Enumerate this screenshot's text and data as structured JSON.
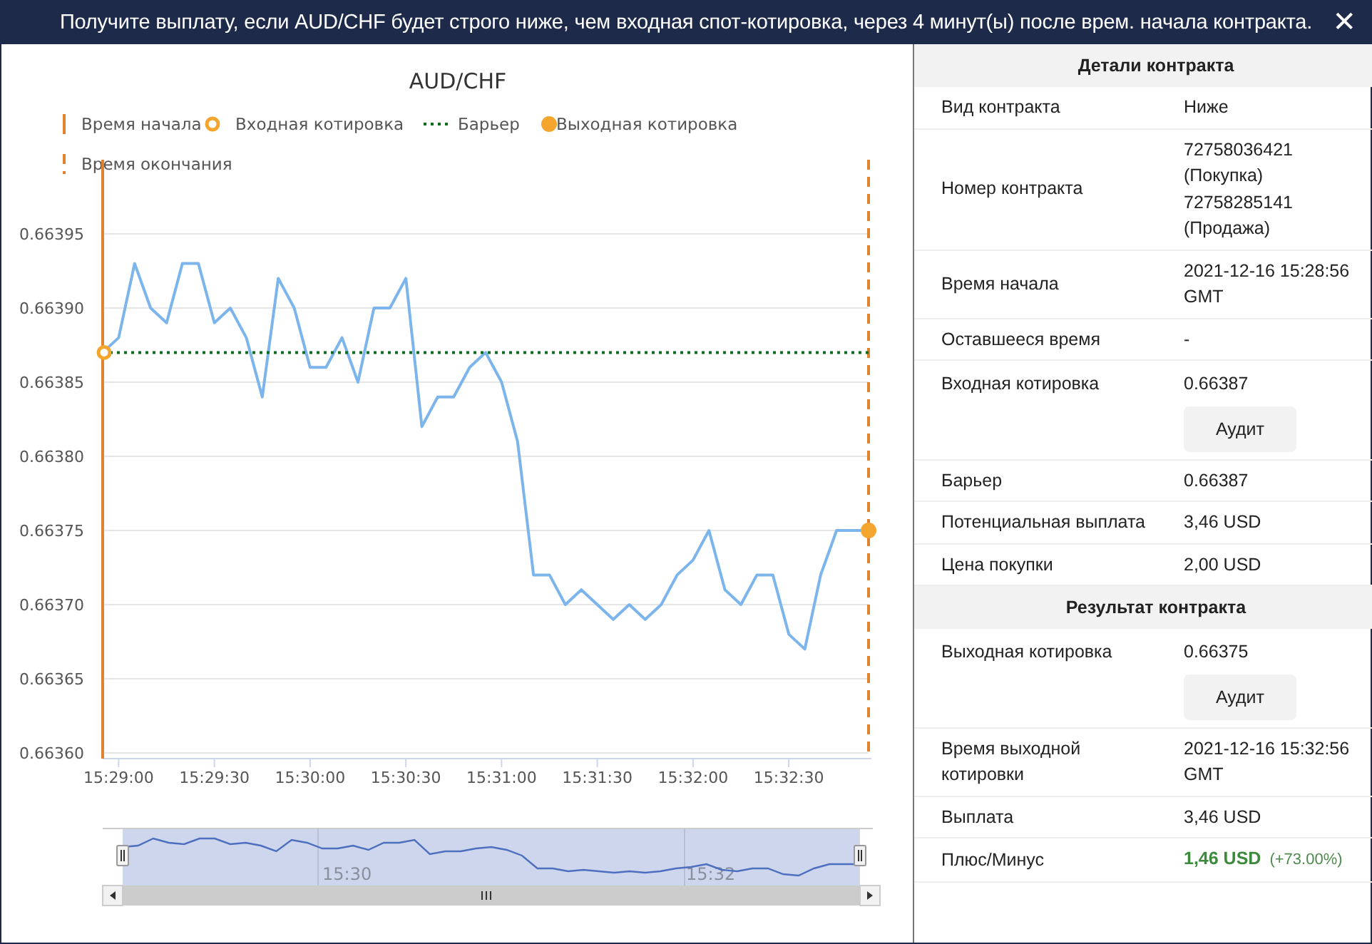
{
  "window": {
    "title": "Получите выплату, если AUD/CHF будет строго ниже, чем входная спот-котировка, через 4 минут(ы) после врем. начала контракта.",
    "close": "✕"
  },
  "chart": {
    "title": "AUD/CHF",
    "legend": [
      {
        "kind": "start_line",
        "label": "Время начала"
      },
      {
        "kind": "entry_spot",
        "label": "Входная котировка"
      },
      {
        "kind": "barrier",
        "label": "Барьер"
      },
      {
        "kind": "exit_spot",
        "label": "Выходная котировка"
      },
      {
        "kind": "end_line",
        "label": "Время окончания"
      }
    ],
    "chart_data": {
      "type": "line",
      "categories": [
        null,
        "15:29:00",
        null,
        null,
        null,
        null,
        null,
        "15:29:30",
        null,
        null,
        null,
        null,
        null,
        "15:30:00",
        null,
        null,
        null,
        null,
        null,
        "15:30:30",
        null,
        null,
        null,
        null,
        null,
        "15:31:00",
        null,
        null,
        null,
        null,
        null,
        "15:31:30",
        null,
        null,
        null,
        null,
        null,
        "15:32:00",
        null,
        null,
        null,
        null,
        null,
        "15:32:30",
        null,
        null,
        null,
        null,
        null
      ],
      "series": [
        {
          "color": "#7cb5ec",
          "values": [
            0.66387,
            0.66388,
            0.66393,
            0.6639,
            0.66389,
            0.66393,
            0.66393,
            0.66389,
            0.6639,
            0.66388,
            0.66384,
            0.66392,
            0.6639,
            0.66386,
            0.66386,
            0.66388,
            0.66385,
            0.6639,
            0.6639,
            0.66392,
            0.66382,
            0.66384,
            0.66384,
            0.66386,
            0.66387,
            0.66385,
            0.66381,
            0.66372,
            0.66372,
            0.6637,
            0.66371,
            0.6637,
            0.66369,
            0.6637,
            0.66369,
            0.6637,
            0.66372,
            0.66373,
            0.66375,
            0.66371,
            0.6637,
            0.66372,
            0.66372,
            0.66368,
            0.66367,
            0.66372,
            0.66375,
            0.66375,
            0.66375
          ]
        }
      ],
      "ylim": [
        0.6636,
        0.664
      ],
      "yticks": [
        {
          "value": 0.6636,
          "label": "0.66360"
        },
        {
          "value": 0.66365,
          "label": "0.66365"
        },
        {
          "value": 0.6637,
          "label": "0.66370"
        },
        {
          "value": 0.66375,
          "label": "0.66375"
        },
        {
          "value": 0.6638,
          "label": "0.66380"
        },
        {
          "value": 0.66385,
          "label": "0.66385"
        },
        {
          "value": 0.6639,
          "label": "0.66390"
        },
        {
          "value": 0.66395,
          "label": "0.66395"
        }
      ],
      "grid": true,
      "ref_lines": [
        {
          "axis": "y",
          "value": 0.66387
        }
      ]
    },
    "navigator": {
      "labels": [
        "15:30",
        "15:32"
      ]
    }
  },
  "details": [
    {
      "kind": "header",
      "label": "Детали контракта"
    },
    {
      "kind": "text",
      "label": "Вид контракта",
      "value": "Ниже"
    },
    {
      "kind": "text",
      "label": "Номер контракта",
      "value": "72758036421 (Покупка) 72758285141 (Продажа)"
    },
    {
      "kind": "text",
      "label": "Время начала",
      "value": "2021-12-16 15:28:56 GMT"
    },
    {
      "kind": "text",
      "label": "Оставшееся время",
      "value": "-"
    },
    {
      "kind": "audit",
      "label": "Входная котировка",
      "value": "0.66387",
      "button": "Аудит"
    },
    {
      "kind": "text",
      "label": "Барьер",
      "value": "0.66387"
    },
    {
      "kind": "text",
      "label": "Потенциальная выплата",
      "value": "3,46 USD"
    },
    {
      "kind": "text",
      "label": "Цена покупки",
      "value": "2,00 USD"
    },
    {
      "kind": "header",
      "label": "Результат контракта"
    },
    {
      "kind": "audit",
      "label": "Выходная котировка",
      "value": "0.66375",
      "button": "Аудит"
    },
    {
      "kind": "text",
      "label": "Время выходной котировки",
      "value": "2021-12-16 15:32:56 GMT"
    },
    {
      "kind": "text",
      "label": "Выплата",
      "value": "3,46 USD"
    },
    {
      "kind": "profit",
      "label": "Плюс/Минус",
      "value": "1,46 USD",
      "note": "(+73.00%)"
    }
  ]
}
